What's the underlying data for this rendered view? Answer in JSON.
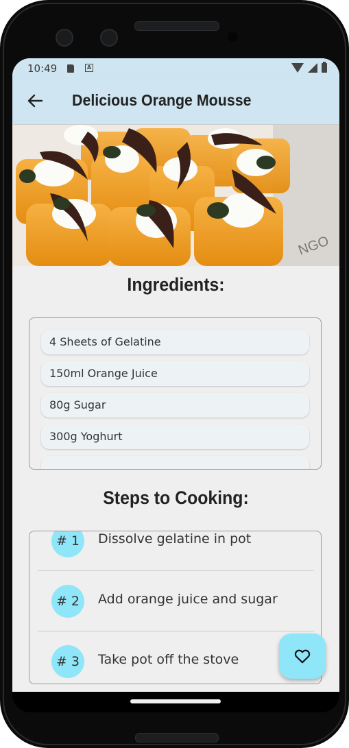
{
  "status_bar": {
    "time": "10:49",
    "icons": [
      "sd-card-icon",
      "a-notification-icon",
      "wifi-icon",
      "cellular-signal-icon",
      "battery-icon"
    ]
  },
  "app_bar": {
    "title": "Delicious Orange Mousse",
    "back_icon": "arrow-left-icon",
    "background_color": "#cfe6f2"
  },
  "hero_image": {
    "description_icon": "orange-mousse-photo"
  },
  "ingredients": {
    "heading": "Ingredients:",
    "items": [
      "4 Sheets of Gelatine",
      "150ml Orange Juice",
      "80g Sugar",
      "300g Yoghurt"
    ]
  },
  "steps": {
    "heading": "Steps to Cooking:",
    "items": [
      {
        "number": "# 1",
        "text": "Dissolve gelatine in pot"
      },
      {
        "number": "# 2",
        "text": "Add orange juice and sugar"
      },
      {
        "number": "# 3",
        "text": "Take pot off the stove"
      }
    ],
    "badge_color": "#8fe6f8"
  },
  "fab": {
    "icon": "heart-outline-icon",
    "color": "#8fe6f8"
  }
}
